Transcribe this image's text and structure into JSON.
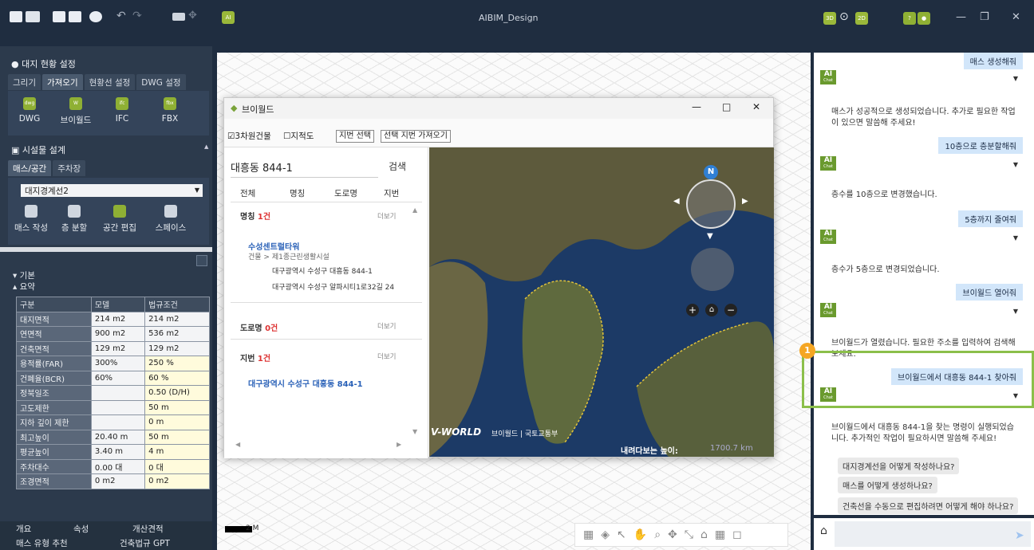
{
  "app": {
    "title": "AIBIM_Design"
  },
  "titlebar": {
    "ai_icon_label": "AI",
    "view_3d": "3D",
    "view_2d": "2D"
  },
  "site": {
    "section_title": "대지 현황 설정",
    "tabs": [
      "그리기",
      "가져오기",
      "현황선 설정",
      "DWG 설정"
    ],
    "tools": [
      {
        "label": "DWG",
        "icon": "dwg-icon"
      },
      {
        "label": "브이월드",
        "icon": "vworld-icon"
      },
      {
        "label": "IFC",
        "icon": "ifc-icon"
      },
      {
        "label": "FBX",
        "icon": "fbx-icon"
      }
    ]
  },
  "facility": {
    "section_title": "시설물 설계",
    "tabs": [
      "매스/공간",
      "주차장"
    ],
    "dropdown_value": "대지경계선2",
    "tools": [
      "매스 작성",
      "층 분할",
      "공간 편집",
      "스페이스"
    ]
  },
  "summary": {
    "basic_label": "기본",
    "summary_label": "요약",
    "headers": [
      "구분",
      "모델",
      "법규조건"
    ],
    "rows": [
      [
        "대지면적",
        "214 m2",
        "214 m2"
      ],
      [
        "연면적",
        "900 m2",
        "536 m2"
      ],
      [
        "건축면적",
        "129 m2",
        "129 m2"
      ],
      [
        "용적률(FAR)",
        "300%",
        "250 %"
      ],
      [
        "건폐율(BCR)",
        "60%",
        "60 %"
      ],
      [
        "정북일조",
        "",
        "0.50 (D/H)"
      ],
      [
        "고도제한",
        "",
        "50 m"
      ],
      [
        "지하 깊이 제한",
        "",
        "0 m"
      ],
      [
        "최고높이",
        "20.40 m",
        "50 m"
      ],
      [
        "평균높이",
        "3.40 m",
        "4 m"
      ],
      [
        "주차대수",
        "0.00 대",
        "0 대"
      ],
      [
        "조경면적",
        "0 m2",
        "0 m2"
      ]
    ]
  },
  "bottom_tabs": [
    "개요",
    "속성",
    "개산견적"
  ],
  "bottom_tabs2": [
    "매스 유형 추천",
    "건축법규 GPT"
  ],
  "scale": {
    "label": "2 M"
  },
  "vworld": {
    "title": "브이월드",
    "check_3d": "3차원건물",
    "check_cadastral": "지적도",
    "btn_select": "지번 선택",
    "btn_import": "선택 지번 가져오기",
    "search_value": "대흥동 844-1",
    "search_button": "검색",
    "tabs": [
      "전체",
      "명칭",
      "도로명",
      "지번"
    ],
    "name_section": {
      "label": "명칭",
      "count": "1건",
      "more": "더보기"
    },
    "name_result": {
      "title": "수성센트럴타워",
      "category": "건물 > 제1종근린생활시설",
      "addr1": "대구광역시 수성구 대흥동 844-1",
      "addr2": "대구광역시 수성구 알파시티1로32길 24"
    },
    "road_section": {
      "label": "도로명",
      "count": "0건",
      "more": "더보기"
    },
    "lot_section": {
      "label": "지번",
      "count": "1건",
      "more": "더보기"
    },
    "lot_result": "대구광역시 수성구 대흥동 844-1",
    "map_logo": "V-WORLD",
    "map_logo_sub": "브이월드 | 국토교통부",
    "map_height_label": "내려다보는 높이:",
    "map_height_value": "1700.7 km",
    "compass_n": "N"
  },
  "chat": {
    "messages": [
      {
        "type": "user",
        "text": "매스 생성해줘"
      },
      {
        "type": "ai",
        "text": "매스가 성공적으로 생성되었습니다. 추가로 필요한 작업이 있으면 말씀해 주세요!"
      },
      {
        "type": "user",
        "text": "10층으로 층분할해줘"
      },
      {
        "type": "ai",
        "text": "층수를 10층으로 변경했습니다."
      },
      {
        "type": "user",
        "text": "5층까지 줄여줘"
      },
      {
        "type": "ai",
        "text": "층수가 5층으로 변경되었습니다."
      },
      {
        "type": "user",
        "text": "브이월드 열어줘"
      },
      {
        "type": "ai",
        "text": "브이월드가 열렸습니다. 필요한 주소를 입력하여 검색해 보세요."
      },
      {
        "type": "user",
        "text": "브이월드에서 대흥동 844-1 찾아줘"
      },
      {
        "type": "ai",
        "text": "브이월드에서 대흥동 844-1을 찾는 명령이 실행되었습니다. 추가적인 작업이 필요하시면 말씀해 주세요!"
      }
    ],
    "ai_badge": "AI",
    "ai_badge_sub": "Chat",
    "suggestions": [
      "대지경계선을 어떻게 작성하나요?",
      "매스를 어떻게 생성하나요?",
      "건축선을 수동으로 편집하려면 어떻게 해야 하나요?"
    ]
  },
  "callout": {
    "number": "1",
    "color": "#f5a623",
    "box_color": "#8bbf4a"
  }
}
